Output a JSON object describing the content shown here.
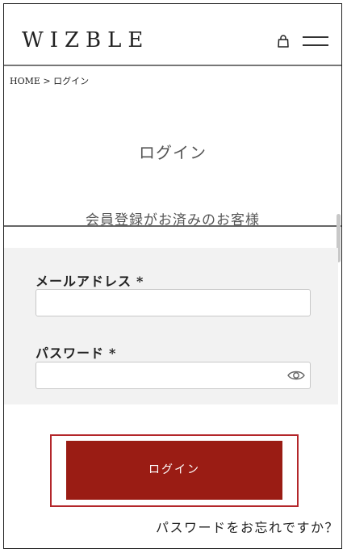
{
  "header": {
    "logo": "WIZBLE"
  },
  "breadcrumb": "HOME > ログイン",
  "page_title": "ログイン",
  "section_title": "会員登録がお済みのお客様",
  "form": {
    "email_label": "メールアドレス",
    "password_label": "パスワード",
    "required_mark": "*",
    "email_value": "",
    "password_value": ""
  },
  "login_button": "ログイン",
  "forgot_password": "パスワードをお忘れですか？",
  "colors": {
    "accent": "#9a1c14",
    "outline": "#b3262a",
    "panel": "#f2f2f2"
  },
  "icons": [
    "bag-icon",
    "menu-icon",
    "eye-icon"
  ]
}
